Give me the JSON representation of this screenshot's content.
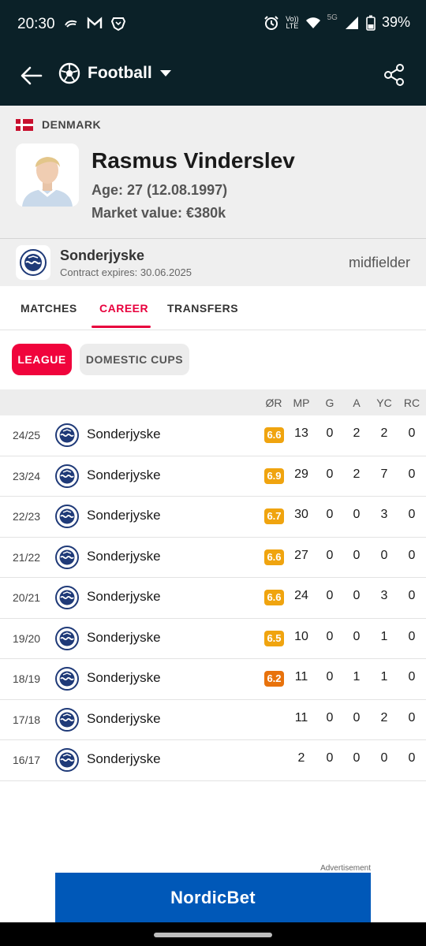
{
  "status_bar": {
    "time": "20:30",
    "battery": "39%",
    "network_label_top": "Vo))",
    "network_label_bottom": "LTE",
    "network_5g": "5G"
  },
  "app_bar": {
    "title": "Football",
    "back_icon": "arrow-left-icon",
    "sport_icon": "soccer-ball-icon",
    "share_icon": "share-icon",
    "color": "#0b2128"
  },
  "player": {
    "country": "DENMARK",
    "name": "Rasmus Vinderslev",
    "age": "Age: 27 (12.08.1997)",
    "market_value": "Market value: €380k"
  },
  "team": {
    "name": "Sonderjyske",
    "contract": "Contract expires: 30.06.2025",
    "position": "midfielder"
  },
  "tabs": [
    {
      "label": "MATCHES",
      "active": false
    },
    {
      "label": "CAREER",
      "active": true
    },
    {
      "label": "TRANSFERS",
      "active": false
    }
  ],
  "filters": [
    {
      "label": "LEAGUE",
      "active": true
    },
    {
      "label": "DOMESTIC CUPS",
      "active": false
    }
  ],
  "table": {
    "headers": [
      "ØR",
      "MP",
      "G",
      "A",
      "YC",
      "RC"
    ],
    "rows": [
      {
        "season": "24/25",
        "team": "Sonderjyske",
        "rating": "6.6",
        "mp": "13",
        "g": "0",
        "a": "2",
        "yc": "2",
        "rc": "0"
      },
      {
        "season": "23/24",
        "team": "Sonderjyske",
        "rating": "6.9",
        "mp": "29",
        "g": "0",
        "a": "2",
        "yc": "7",
        "rc": "0"
      },
      {
        "season": "22/23",
        "team": "Sonderjyske",
        "rating": "6.7",
        "mp": "30",
        "g": "0",
        "a": "0",
        "yc": "3",
        "rc": "0"
      },
      {
        "season": "21/22",
        "team": "Sonderjyske",
        "rating": "6.6",
        "mp": "27",
        "g": "0",
        "a": "0",
        "yc": "0",
        "rc": "0"
      },
      {
        "season": "20/21",
        "team": "Sonderjyske",
        "rating": "6.6",
        "mp": "24",
        "g": "0",
        "a": "0",
        "yc": "3",
        "rc": "0"
      },
      {
        "season": "19/20",
        "team": "Sonderjyske",
        "rating": "6.5",
        "mp": "10",
        "g": "0",
        "a": "0",
        "yc": "1",
        "rc": "0"
      },
      {
        "season": "18/19",
        "team": "Sonderjyske",
        "rating": "6.2",
        "mp": "11",
        "g": "0",
        "a": "1",
        "yc": "1",
        "rc": "0"
      },
      {
        "season": "17/18",
        "team": "Sonderjyske",
        "rating": "",
        "mp": "11",
        "g": "0",
        "a": "0",
        "yc": "2",
        "rc": "0"
      },
      {
        "season": "16/17",
        "team": "Sonderjyske",
        "rating": "",
        "mp": "2",
        "g": "0",
        "a": "0",
        "yc": "0",
        "rc": "0"
      }
    ]
  },
  "rating_colors": {
    "6.2": "#e8720c",
    "default": "#f0a40f"
  },
  "ad": {
    "label": "Advertisement",
    "brand": "NordicBet"
  }
}
